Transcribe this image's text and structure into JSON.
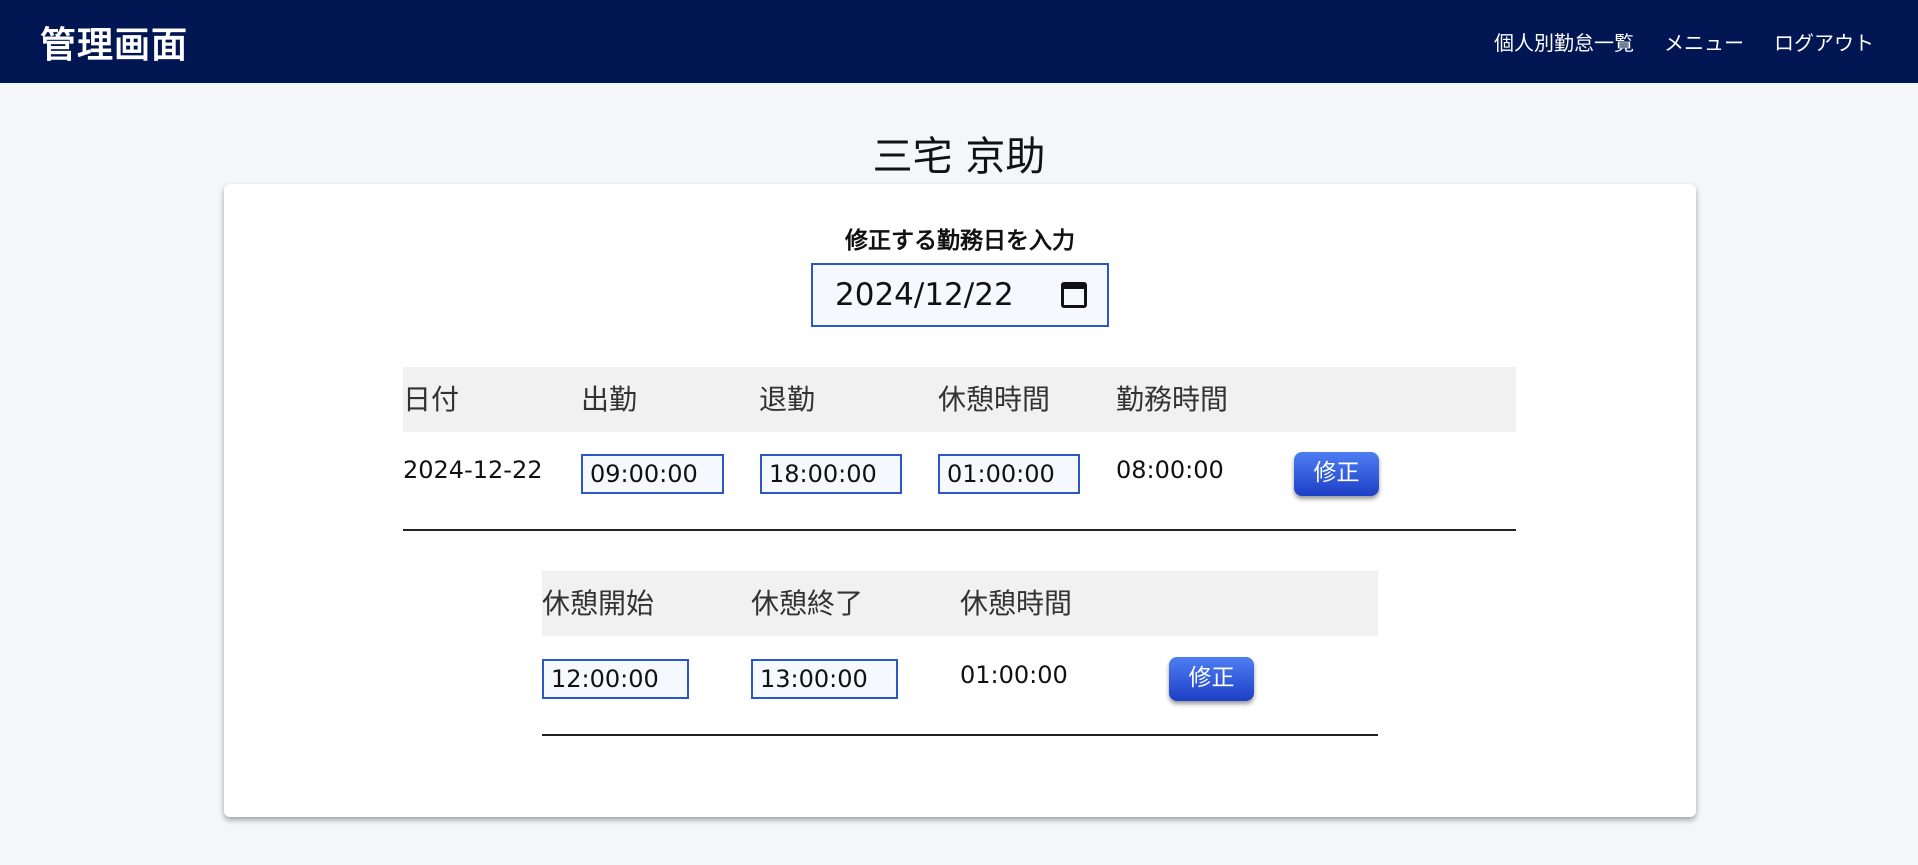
{
  "header": {
    "title": "管理画面",
    "nav": [
      "個人別勤怠一覧",
      "メニュー",
      "ログアウト"
    ]
  },
  "employee": {
    "name": "三宅 京助"
  },
  "date_picker": {
    "label": "修正する勤務日を入力",
    "value": "2024/12/22",
    "icon": "calendar-icon"
  },
  "attendance_table": {
    "headers": [
      "日付",
      "出勤",
      "退勤",
      "休憩時間",
      "勤務時間"
    ],
    "row": {
      "date": "2024-12-22",
      "clock_in": "09:00:00",
      "clock_out": "18:00:00",
      "break_time": "01:00:00",
      "work_time": "08:00:00",
      "button": "修正"
    }
  },
  "break_table": {
    "headers": [
      "休憩開始",
      "休憩終了",
      "休憩時間"
    ],
    "row": {
      "start": "12:00:00",
      "end": "13:00:00",
      "duration": "01:00:00",
      "button": "修正"
    }
  },
  "colors": {
    "header_bg": "#011652",
    "page_bg": "#f5f6f8",
    "accent": "#2b58c8",
    "button": "#2f5ce0"
  }
}
